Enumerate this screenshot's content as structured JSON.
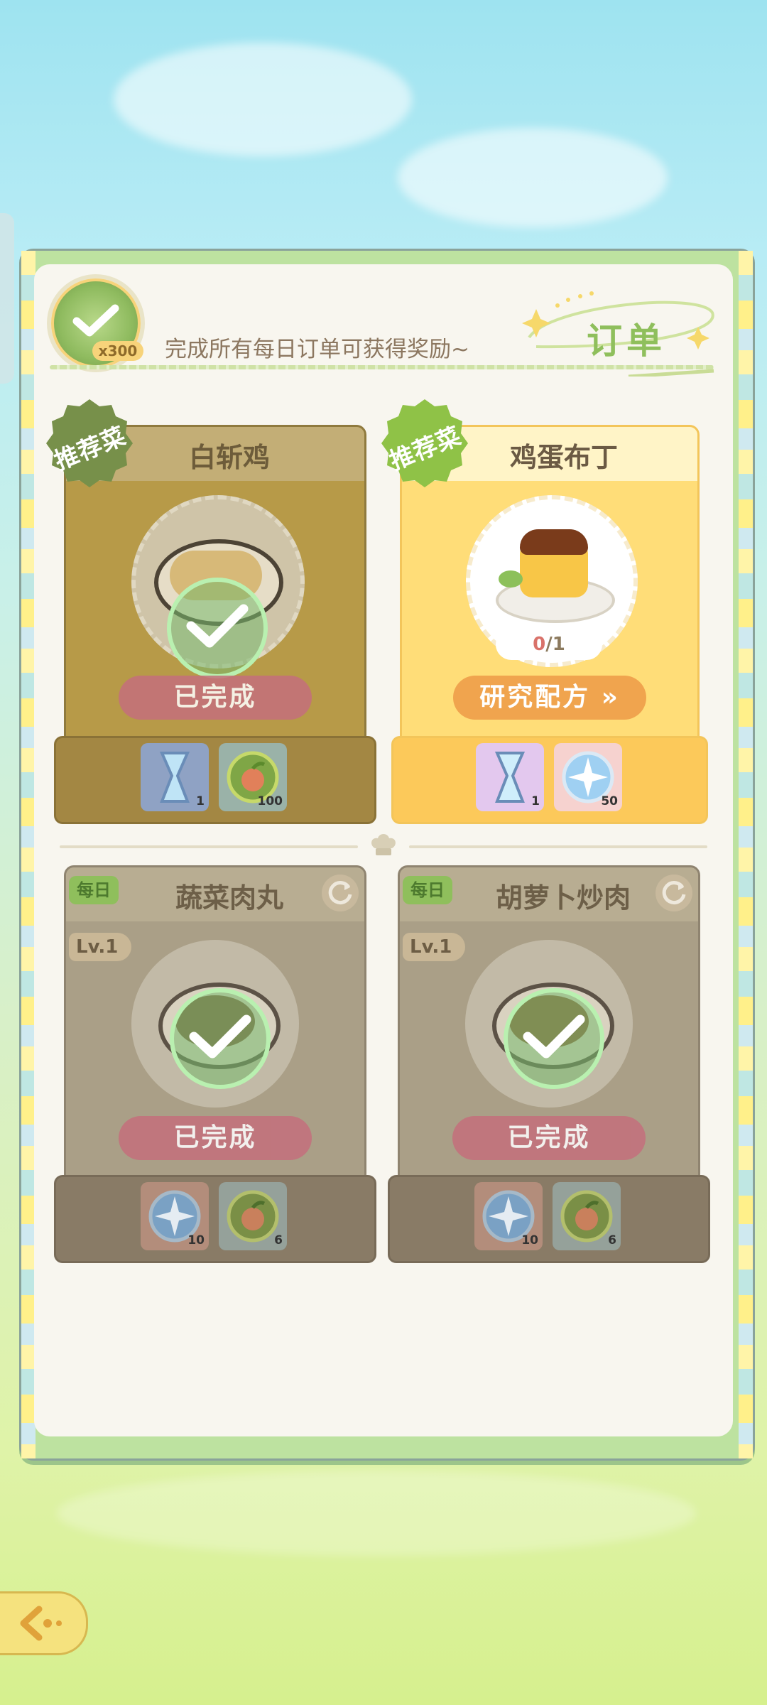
{
  "header": {
    "badge_count": "x300",
    "message": "完成所有每日订单可获得奖励~",
    "title": "订单"
  },
  "recommended": [
    {
      "badge": "推荐菜",
      "dish": "白斩鸡",
      "status": "已完成",
      "rewards": [
        {
          "icon": "hourglass-icon",
          "qty": "1"
        },
        {
          "icon": "fruit-token-icon",
          "qty": "100"
        }
      ]
    },
    {
      "badge": "推荐菜",
      "dish": "鸡蛋布丁",
      "progress_done": "0",
      "progress_total": "/1",
      "action": "研究配方 »",
      "rewards": [
        {
          "icon": "hourglass-icon",
          "qty": "1"
        },
        {
          "icon": "star-token-icon",
          "qty": "50"
        }
      ]
    }
  ],
  "daily": [
    {
      "tag": "每日",
      "level": "Lv.1",
      "dish": "蔬菜肉丸",
      "status": "已完成",
      "rewards": [
        {
          "icon": "star-token-icon",
          "qty": "10"
        },
        {
          "icon": "fruit-token-icon",
          "qty": "6"
        }
      ]
    },
    {
      "tag": "每日",
      "level": "Lv.1",
      "dish": "胡萝卜炒肉",
      "status": "已完成",
      "rewards": [
        {
          "icon": "star-token-icon",
          "qty": "10"
        },
        {
          "icon": "fruit-token-icon",
          "qty": "6"
        }
      ]
    }
  ],
  "colors": {
    "completed_card": "#b79a48",
    "active_card": "#ffdd78",
    "daily_card": "#aa9f87",
    "status_pill": "#c46f7c",
    "action_pill": "#f0a44e",
    "accent_green": "#8fbf5c"
  }
}
